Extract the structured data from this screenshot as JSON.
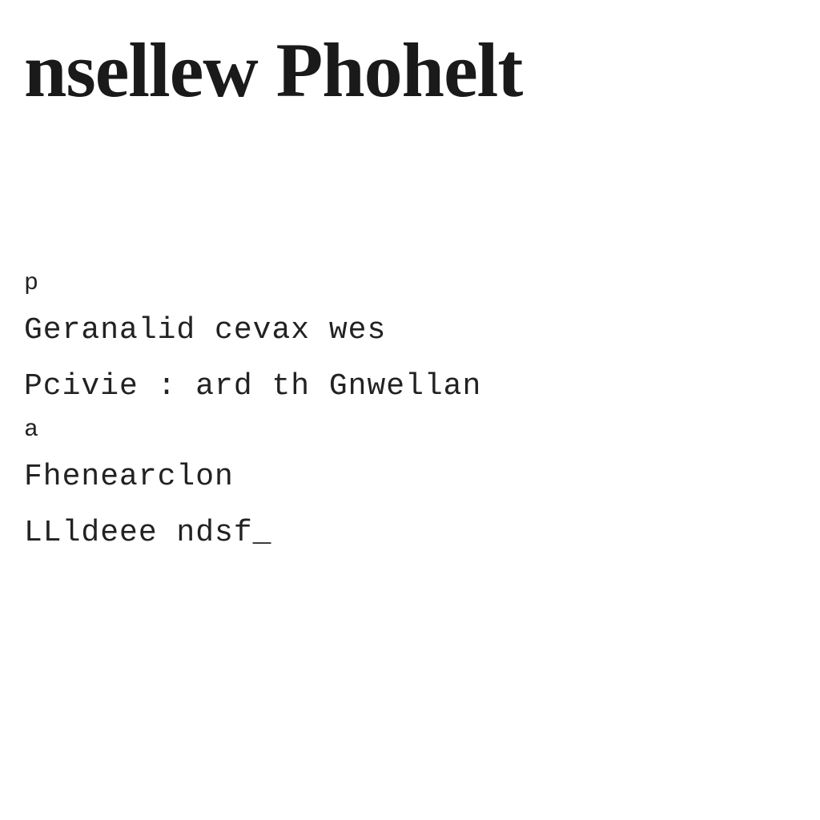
{
  "title": "nsellew Phohelt",
  "body": {
    "lines": [
      "p",
      "Geranalid cevax wes",
      "Pcivie : ard th Gnwellan",
      "a",
      "Fhenearclon",
      "LLldeee ndsf_"
    ]
  }
}
